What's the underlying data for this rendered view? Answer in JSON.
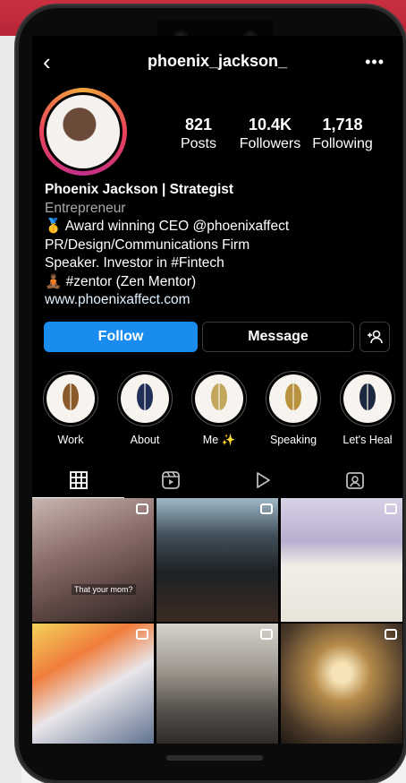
{
  "profile": {
    "username": "phoenix_jackson_",
    "stats": [
      {
        "value": "821",
        "label": "Posts"
      },
      {
        "value": "10.4K",
        "label": "Followers"
      },
      {
        "value": "1,718",
        "label": "Following"
      }
    ],
    "bio": {
      "name": "Phoenix Jackson | Strategist",
      "category": "Entrepreneur",
      "line1": "🥇 Award winning CEO @phoenixaffect",
      "line2": "PR/Design/Communications Firm",
      "line3": "Speaker. Investor in #Fintech",
      "line4": "🧘🏾 #zentor (Zen Mentor)",
      "link": "www.phoenixaffect.com"
    }
  },
  "actions": {
    "follow": "Follow",
    "message": "Message"
  },
  "highlights": [
    {
      "label": "Work"
    },
    {
      "label": "About"
    },
    {
      "label": "Me ✨"
    },
    {
      "label": "Speaking"
    },
    {
      "label": "Let's Heal"
    }
  ],
  "tabs": [
    {
      "icon": "grid-icon"
    },
    {
      "icon": "reels-icon"
    },
    {
      "icon": "video-play-icon"
    },
    {
      "icon": "tagged-icon"
    }
  ],
  "posts": {
    "post1_caption": "That your mom?"
  },
  "colors": {
    "follow_button": "#1a8cf0",
    "background": "#000000",
    "story_ring_gradient": [
      "#f2a93b",
      "#e8435a",
      "#c22e8a"
    ]
  }
}
